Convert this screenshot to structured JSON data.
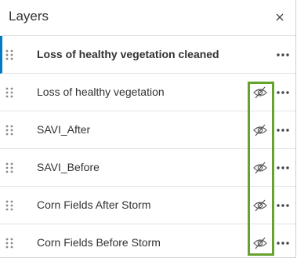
{
  "panel": {
    "title": "Layers",
    "close_icon": "close-icon"
  },
  "layers": [
    {
      "label": "Loss of healthy vegetation cleaned",
      "selected": true,
      "visibility_icon": null
    },
    {
      "label": "Loss of healthy vegetation",
      "selected": false,
      "visibility_icon": "eye-off-icon"
    },
    {
      "label": "SAVI_After",
      "selected": false,
      "visibility_icon": "eye-off-icon"
    },
    {
      "label": "SAVI_Before",
      "selected": false,
      "visibility_icon": "eye-off-icon"
    },
    {
      "label": "Corn Fields After Storm",
      "selected": false,
      "visibility_icon": "eye-off-icon"
    },
    {
      "label": "Corn Fields Before Storm",
      "selected": false,
      "visibility_icon": "eye-off-icon"
    }
  ],
  "colors": {
    "selected_accent": "#007ac2",
    "highlight_box": "#66a22e",
    "text": "#323232"
  }
}
